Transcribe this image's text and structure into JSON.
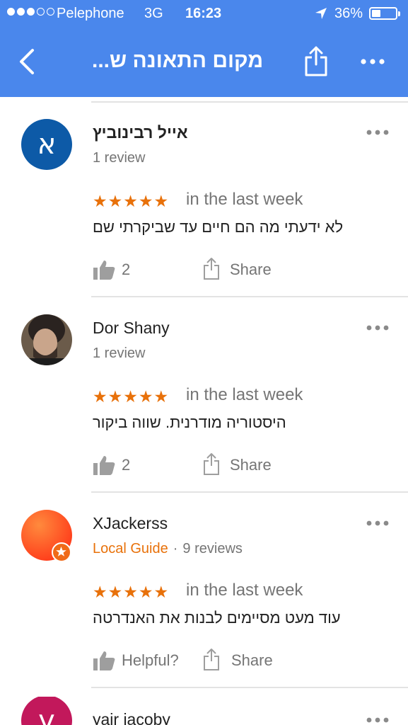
{
  "status_bar": {
    "carrier": "Pelephone",
    "network": "3G",
    "time": "16:23",
    "battery": "36%",
    "battery_level": 0.36,
    "signal_bars": 3
  },
  "app_bar": {
    "title": "מקום התאונה ש...",
    "back_icon": "chevron-left-icon",
    "share_icon": "share-icon",
    "more_icon": "more-horizontal-icon"
  },
  "colors": {
    "app_bar": "#4a87ec",
    "star": "#e8710a",
    "local_guide": "#e8710a",
    "secondary_text": "#757575"
  },
  "reviews": [
    {
      "avatar_letter": "א",
      "avatar_color": "#0d5aa7",
      "name": "אייל רבינוביץ",
      "local_guide": "",
      "review_count": "1 review",
      "stars": "★★★★★",
      "rating": 5,
      "when": "in the last week",
      "text": "לא ידעתי מה הם חיים עד שביקרתי שם",
      "likes": "2",
      "helpful": "",
      "share": "Share"
    },
    {
      "avatar_letter": "",
      "avatar_color": "#6b5b4a",
      "name": "Dor Shany",
      "local_guide": "",
      "review_count": "1 review",
      "stars": "★★★★★",
      "rating": 5,
      "when": "in the last week",
      "text": "היסטוריה מודרנית. שווה ביקור",
      "likes": "2",
      "helpful": "",
      "share": "Share"
    },
    {
      "avatar_letter": "",
      "avatar_color": "#ff4a1c",
      "name": "XJackerss",
      "local_guide": "Local Guide",
      "review_count": "9 reviews",
      "stars": "★★★★★",
      "rating": 5,
      "when": "in the last week",
      "text": "עוד מעט מסיימים לבנות את האנדרטה",
      "likes": "",
      "helpful": "Helpful?",
      "share": "Share"
    },
    {
      "avatar_letter": "y",
      "avatar_color": "#c2185b",
      "name": "yair jacoby"
    }
  ]
}
